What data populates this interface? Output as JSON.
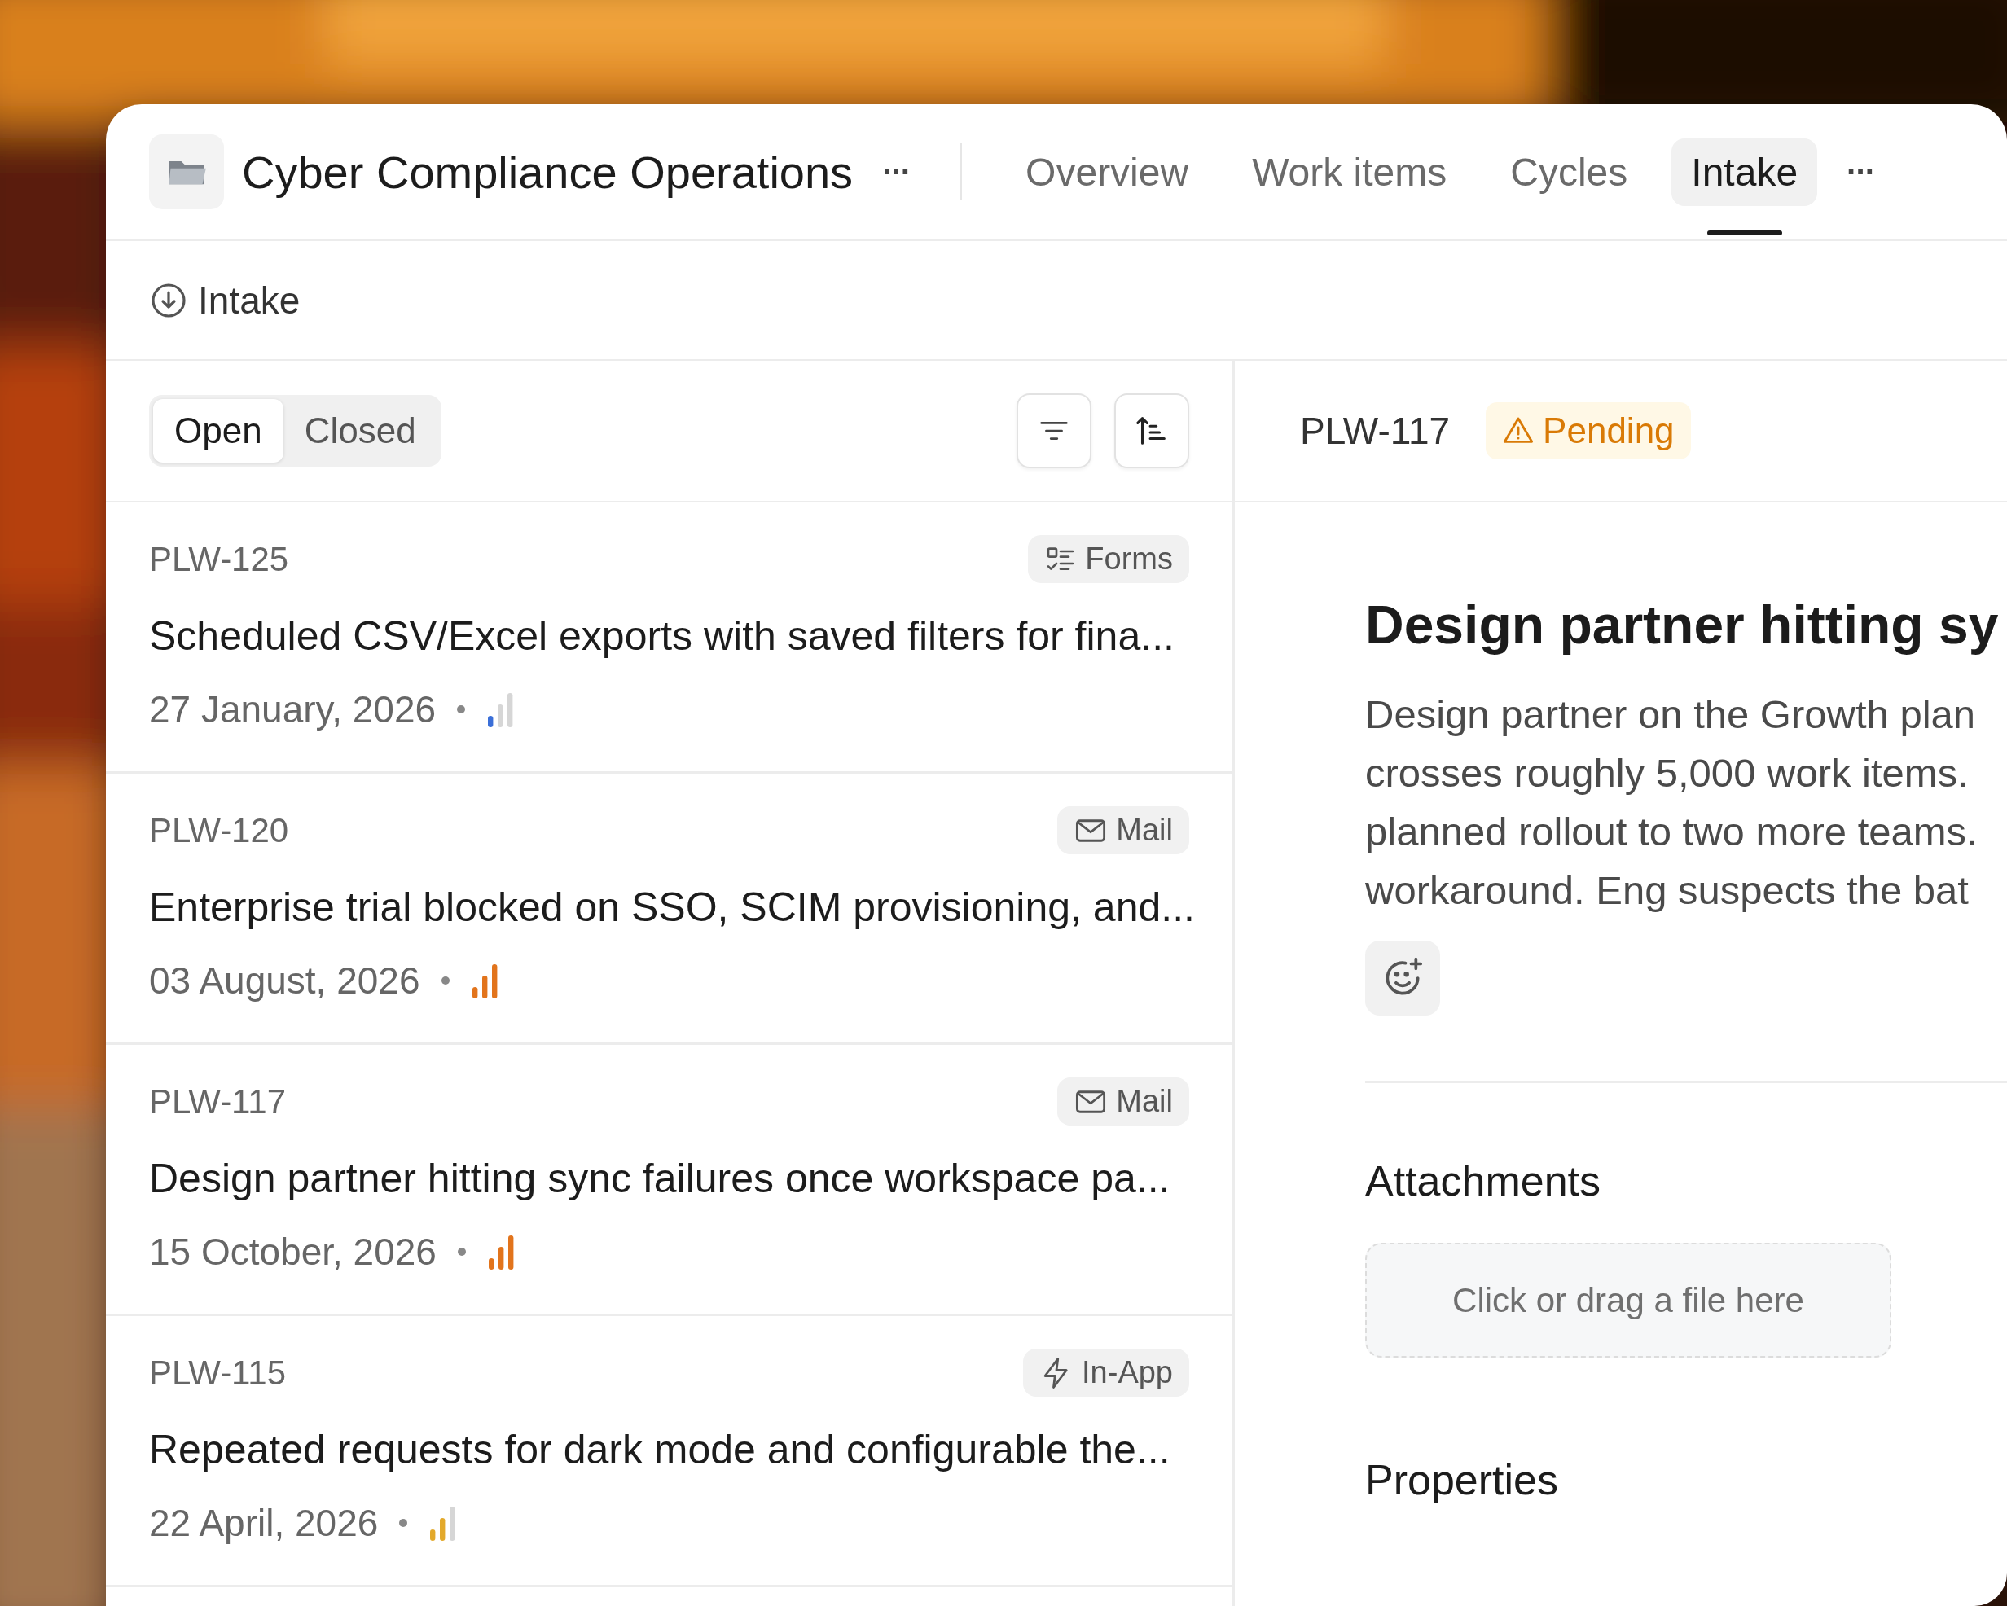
{
  "project": {
    "title": "Cyber Compliance Operations",
    "more": "···"
  },
  "tabs": [
    {
      "label": "Overview",
      "selected": false
    },
    {
      "label": "Work items",
      "selected": false
    },
    {
      "label": "Cycles",
      "selected": false
    },
    {
      "label": "Intake",
      "selected": true
    }
  ],
  "tabs_more": "···",
  "breadcrumb": "Intake",
  "filter_toggle": [
    {
      "label": "Open",
      "selected": true
    },
    {
      "label": "Closed",
      "selected": false
    }
  ],
  "items": [
    {
      "id": "PLW-125",
      "source": {
        "kind": "forms",
        "label": "Forms"
      },
      "title": "Scheduled CSV/Excel exports with saved filters for fina...",
      "date": "27 January, 2026",
      "kind": "low-priority",
      "color": "#3b6fd8"
    },
    {
      "id": "PLW-120",
      "source": {
        "kind": "mail",
        "label": "Mail"
      },
      "title": "Enterprise trial blocked on SSO, SCIM provisioning, and...",
      "date": "03 August, 2026",
      "kind": "high-priority",
      "color": "#e2741c"
    },
    {
      "id": "PLW-117",
      "source": {
        "kind": "mail",
        "label": "Mail"
      },
      "title": "Design partner hitting sync failures once workspace pa...",
      "date": "15 October, 2026",
      "kind": "high-priority",
      "color": "#e2741c"
    },
    {
      "id": "PLW-115",
      "source": {
        "kind": "in-app",
        "label": "In-App"
      },
      "title": "Repeated requests for dark mode and configurable the...",
      "date": "22 April, 2026",
      "kind": "medium-priority",
      "color": "#e3a92b"
    }
  ],
  "detail": {
    "id": "PLW-117",
    "status": {
      "kind": "pending",
      "label": "Pending"
    },
    "title": "Design partner hitting sy",
    "description_lines": [
      "Design partner on the Growth plan",
      "crosses roughly 5,000 work items.",
      "planned rollout to two more teams.",
      "workaround. Eng suspects the bat"
    ],
    "attachments_heading": "Attachments",
    "dropzone": "Click or drag a file here",
    "properties_heading": "Properties"
  }
}
